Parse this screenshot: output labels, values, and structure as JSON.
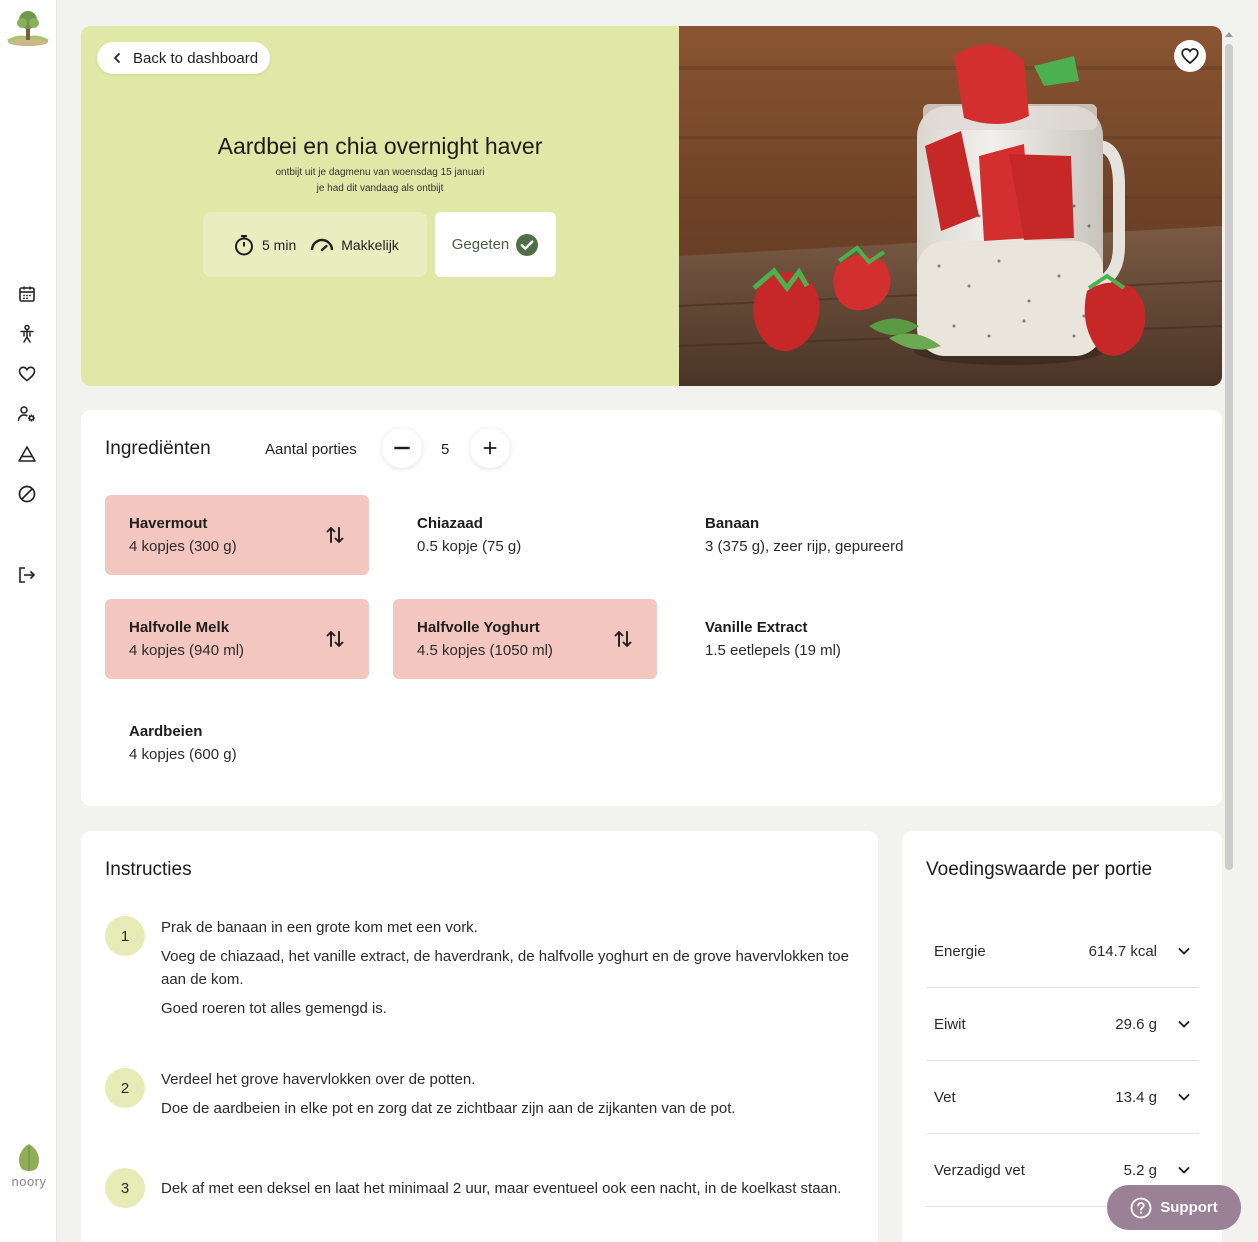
{
  "brand": {
    "name": "noory"
  },
  "hero": {
    "back_label": "Back to dashboard",
    "title": "Aardbei en chia overnight haver",
    "subtitle_line1": "ontbijt uit je dagmenu van woensdag 15 januari",
    "subtitle_line2": "je had dit vandaag als ontbijt",
    "time": "5 min",
    "difficulty": "Makkelijk",
    "eaten_label": "Gegeten"
  },
  "ingredients": {
    "title": "Ingrediënten",
    "portions_label": "Aantal porties",
    "portions_value": "5",
    "items": [
      {
        "name": "Havermout",
        "amount": "4 kopjes (300 g)"
      },
      {
        "name": "Chiazaad",
        "amount": "0.5 kopje (75 g)"
      },
      {
        "name": "Banaan",
        "amount": "3 (375 g), zeer rijp, gepureerd"
      },
      {
        "name": "Halfvolle Melk",
        "amount": "4 kopjes (940 ml)"
      },
      {
        "name": "Halfvolle Yoghurt",
        "amount": "4.5 kopjes (1050 ml)"
      },
      {
        "name": "Vanille Extract",
        "amount": "1.5 eetlepels (19 ml)"
      },
      {
        "name": "Aardbeien",
        "amount": "4 kopjes (600 g)"
      }
    ]
  },
  "instructions": {
    "title": "Instructies",
    "steps": [
      {
        "number": "1",
        "lines": [
          "Prak de banaan in een grote kom met een vork.",
          "Voeg de chiazaad, het vanille extract, de haverdrank, de halfvolle yoghurt en de grove havervlokken toe aan de kom.",
          "Goed roeren tot alles gemengd is."
        ]
      },
      {
        "number": "2",
        "lines": [
          "Verdeel het grove havervlokken over de potten.",
          "Doe de aardbeien in elke pot en zorg dat ze zichtbaar zijn aan de zijkanten van de pot."
        ]
      },
      {
        "number": "3",
        "lines": [
          "Dek af met een deksel en laat het minimaal 2 uur, maar eventueel ook een nacht, in de koelkast staan."
        ]
      }
    ]
  },
  "nutrition": {
    "title": "Voedingswaarde per portie",
    "rows": [
      {
        "label": "Energie",
        "value": "614.7 kcal"
      },
      {
        "label": "Eiwit",
        "value": "29.6 g"
      },
      {
        "label": "Vet",
        "value": "13.4 g"
      },
      {
        "label": "Verzadigd vet",
        "value": "5.2 g"
      }
    ]
  },
  "support": {
    "label": "Support"
  },
  "colors": {
    "hero_bg": "#dfe8a6",
    "swap_bg": "#f4c6c0",
    "step_bg": "#e7ecb6",
    "support_bg": "#9b8195",
    "check_green": "#4f7046"
  }
}
